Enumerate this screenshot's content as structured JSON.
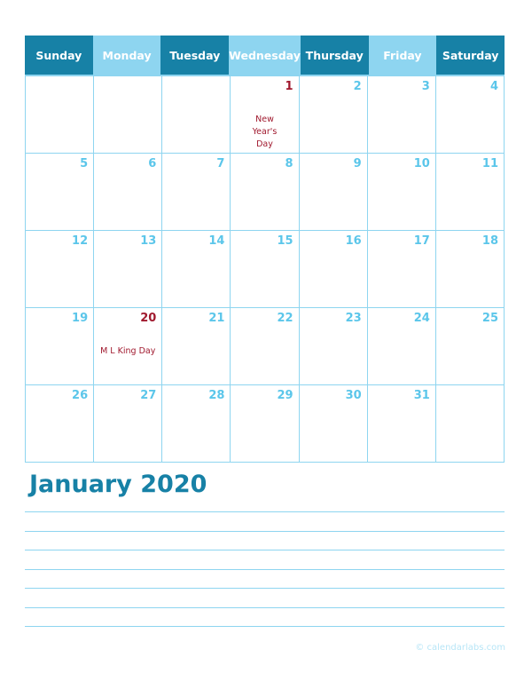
{
  "calendar": {
    "month_title": "January 2020",
    "weekdays": [
      {
        "label": "Sunday",
        "shade": "dark"
      },
      {
        "label": "Monday",
        "shade": "light"
      },
      {
        "label": "Tuesday",
        "shade": "dark"
      },
      {
        "label": "Wednesday",
        "shade": "light"
      },
      {
        "label": "Thursday",
        "shade": "dark"
      },
      {
        "label": "Friday",
        "shade": "light"
      },
      {
        "label": "Saturday",
        "shade": "dark"
      }
    ],
    "days": [
      "",
      "",
      "",
      "1",
      "2",
      "3",
      "4",
      "5",
      "6",
      "7",
      "8",
      "9",
      "10",
      "11",
      "12",
      "13",
      "14",
      "15",
      "16",
      "17",
      "18",
      "19",
      "20",
      "21",
      "22",
      "23",
      "24",
      "25",
      "26",
      "27",
      "28",
      "29",
      "30",
      "31",
      ""
    ],
    "holidays": {
      "1": "New Year's Day",
      "20": "M L King Day"
    },
    "colors": {
      "header_dark": "#1781a6",
      "header_light": "#8ed5f0",
      "day_number": "#5bc6ea",
      "holiday": "#a0192e"
    }
  },
  "notes": {
    "line_count": 7
  },
  "footer": {
    "credit": "© calendarlabs.com"
  }
}
